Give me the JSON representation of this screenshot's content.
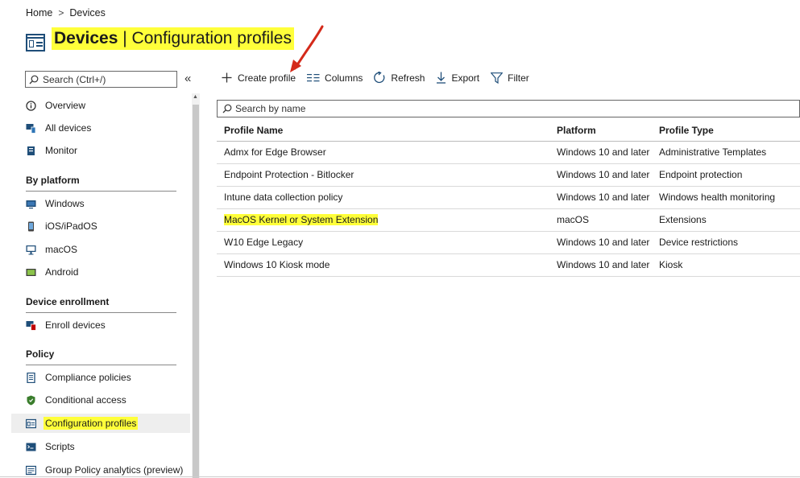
{
  "breadcrumb": {
    "home": "Home",
    "separator": ">",
    "current": "Devices"
  },
  "header": {
    "title_strong": "Devices",
    "title_rest": " | Configuration profiles"
  },
  "sidebar": {
    "search_placeholder": "Search (Ctrl+/)",
    "collapse": "«",
    "items": [
      {
        "label": "Overview",
        "icon": "info-icon"
      },
      {
        "label": "All devices",
        "icon": "devices-icon"
      },
      {
        "label": "Monitor",
        "icon": "monitor-book-icon"
      }
    ],
    "sections": [
      {
        "title": "By platform",
        "items": [
          {
            "label": "Windows",
            "icon": "windows-icon"
          },
          {
            "label": "iOS/iPadOS",
            "icon": "phone-icon"
          },
          {
            "label": "macOS",
            "icon": "desktop-icon"
          },
          {
            "label": "Android",
            "icon": "android-icon"
          }
        ]
      },
      {
        "title": "Device enrollment",
        "items": [
          {
            "label": "Enroll devices",
            "icon": "enroll-icon"
          }
        ]
      },
      {
        "title": "Policy",
        "items": [
          {
            "label": "Compliance policies",
            "icon": "document-icon"
          },
          {
            "label": "Conditional access",
            "icon": "shield-icon"
          },
          {
            "label": "Configuration profiles",
            "icon": "config-profiles-icon",
            "active": true
          },
          {
            "label": "Scripts",
            "icon": "script-icon"
          },
          {
            "label": "Group Policy analytics (preview)",
            "icon": "group-policy-icon"
          }
        ]
      }
    ]
  },
  "toolbar": {
    "create_profile": "Create profile",
    "columns": "Columns",
    "refresh": "Refresh",
    "export": "Export",
    "filter": "Filter"
  },
  "table": {
    "search_placeholder": "Search by name",
    "headers": [
      "Profile Name",
      "Platform",
      "Profile Type"
    ],
    "rows": [
      [
        "Admx for Edge Browser",
        "Windows 10 and later",
        "Administrative Templates"
      ],
      [
        "Endpoint Protection - Bitlocker",
        "Windows 10 and later",
        "Endpoint protection"
      ],
      [
        "Intune data collection policy",
        "Windows 10 and later",
        "Windows health monitoring"
      ],
      [
        "MacOS Kernel or System Extension",
        "macOS",
        "Extensions"
      ],
      [
        "W10 Edge Legacy",
        "Windows 10 and later",
        "Device restrictions"
      ],
      [
        "Windows 10 Kiosk mode",
        "Windows 10 and later",
        "Kiosk"
      ]
    ]
  },
  "colors": {
    "highlight": "#ffff3a",
    "accent": "#1f4e79",
    "annotation_arrow": "#d42a1a"
  }
}
